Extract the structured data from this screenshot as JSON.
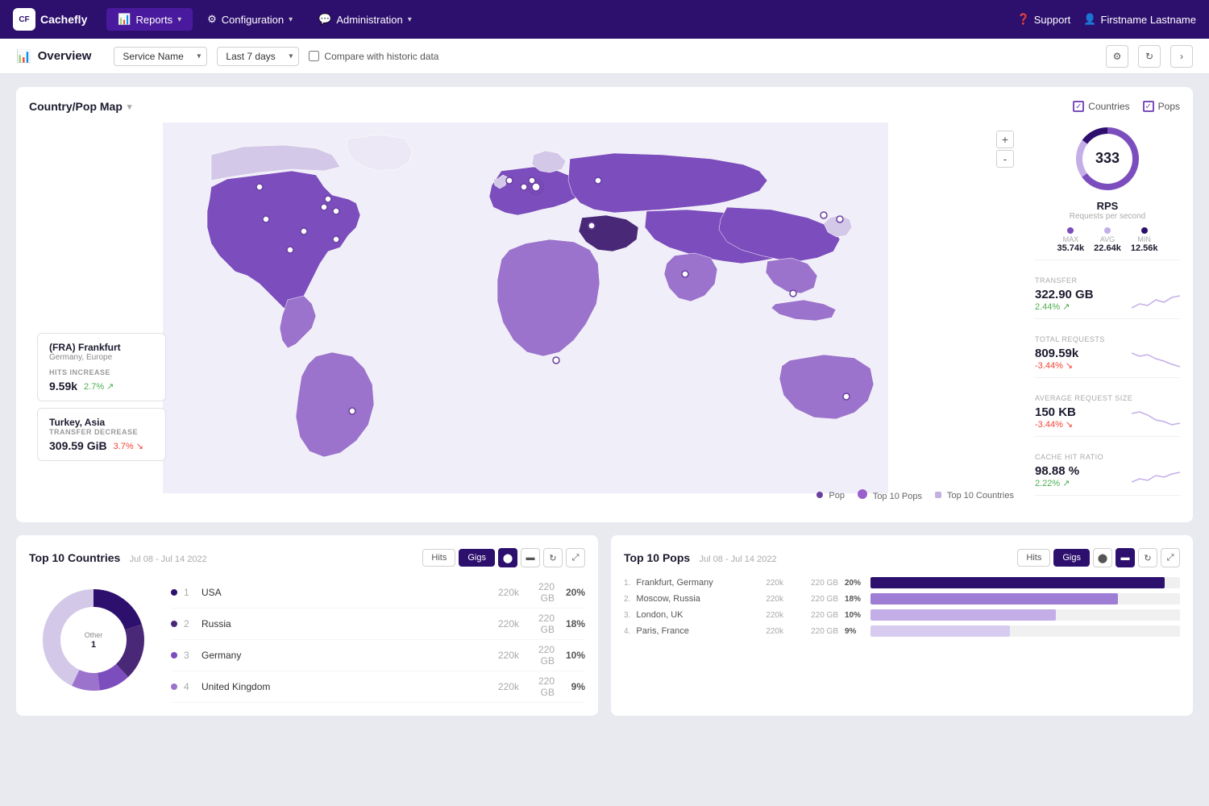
{
  "nav": {
    "logo": "Cachefly",
    "items": [
      {
        "id": "reports",
        "label": "Reports",
        "active": true,
        "icon": "📊"
      },
      {
        "id": "configuration",
        "label": "Configuration",
        "active": false,
        "icon": "⚙"
      },
      {
        "id": "administration",
        "label": "Administration",
        "active": false,
        "icon": "💬"
      }
    ],
    "support_label": "Support",
    "user_label": "Firstname Lastname"
  },
  "toolbar": {
    "title": "Overview",
    "service_name_placeholder": "Service Name",
    "date_range_placeholder": "Last 7 days",
    "compare_label": "Compare with historic data",
    "filter_icon": "filter-icon",
    "refresh_icon": "refresh-icon",
    "forward_icon": "forward-icon"
  },
  "map": {
    "title": "Country/Pop Map",
    "legend_countries": "Countries",
    "legend_pops": "Pops",
    "zoom_in": "+",
    "zoom_out": "-",
    "cards": [
      {
        "id": "frankfurt",
        "title": "(FRA) Frankfurt",
        "subtitle": "Germany, Europe",
        "stat_label": "HITS INCREASE",
        "value": "9.59k",
        "pct": "2.7%",
        "direction": "up"
      },
      {
        "id": "turkey",
        "title": "Turkey, Asia",
        "subtitle": "",
        "stat_label": "TRANSFER DECREASE",
        "value": "309.59 GiB",
        "pct": "3.7%",
        "direction": "down"
      }
    ],
    "bottom_legend": [
      {
        "label": "Pop",
        "color": "#6b3fa0"
      },
      {
        "label": "Top 10 Pops",
        "color": "#9b5fcc"
      },
      {
        "label": "Top 10 Countries",
        "color": "#c4b0e0"
      }
    ]
  },
  "rps": {
    "value": "333",
    "title": "RPS",
    "subtitle": "Requests per second",
    "stats": [
      {
        "label": "MAX",
        "value": "35.74k",
        "color": "#7c4dbd"
      },
      {
        "label": "AVG",
        "value": "22.64k",
        "color": "#c4aee8"
      },
      {
        "label": "MIN",
        "value": "12.56k",
        "color": "#2d0f6e"
      }
    ],
    "donut_segments": [
      {
        "color": "#7c4dbd",
        "pct": 65
      },
      {
        "color": "#c4aee8",
        "pct": 20
      },
      {
        "color": "#2d0f6e",
        "pct": 15
      }
    ]
  },
  "metrics": [
    {
      "id": "transfer",
      "label": "TRANSFER",
      "value": "322.90 GB",
      "pct": "2.44%",
      "direction": "up",
      "sparkline": "up"
    },
    {
      "id": "total_requests",
      "label": "TOTAL REQUESTS",
      "value": "809.59k",
      "pct": "-3.44%",
      "direction": "down",
      "sparkline": "down"
    },
    {
      "id": "avg_request_size",
      "label": "AVERAGE REQUEST SIZE",
      "value": "150 KB",
      "pct": "-3.44%",
      "direction": "down",
      "sparkline": "down"
    },
    {
      "id": "cache_hit_ratio",
      "label": "CACHE HIT RATIO",
      "value": "98.88 %",
      "pct": "2.22%",
      "direction": "up",
      "sparkline": "up"
    }
  ],
  "top_countries": {
    "title": "Top 10 Countries",
    "date_range": "Jul 08 - Jul 14 2022",
    "active_tab": "Gigs",
    "tabs": [
      "Hits",
      "Gigs"
    ],
    "rows": [
      {
        "rank": 1,
        "name": "USA",
        "color": "#2d0f6e",
        "hits": "220k",
        "gigs": "220 GB",
        "pct": "20%"
      },
      {
        "rank": 2,
        "name": "Russia",
        "color": "#4a2878",
        "hits": "220k",
        "gigs": "220 GB",
        "pct": "18%"
      },
      {
        "rank": 3,
        "name": "Germany",
        "color": "#7c4dbd",
        "hits": "220k",
        "gigs": "220 GB",
        "pct": "10%"
      },
      {
        "rank": 4,
        "name": "United Kingdom",
        "color": "#9b73cc",
        "hits": "220k",
        "gigs": "220 GB",
        "pct": "9%"
      }
    ],
    "other_label": "Other"
  },
  "top_pops": {
    "title": "Top 10 Pops",
    "date_range": "Jul 08 - Jul 14 2022",
    "active_tab": "Gigs",
    "tabs": [
      "Hits",
      "Gigs"
    ],
    "rows": [
      {
        "rank": 1,
        "name": "Frankfurt, Germany",
        "hits": "220k",
        "gigs": "220 GB",
        "pct": "20%",
        "bar_pct": 95
      },
      {
        "rank": 2,
        "name": "Moscow, Russia",
        "hits": "220k",
        "gigs": "220 GB",
        "pct": "18%",
        "bar_pct": 80
      },
      {
        "rank": 3,
        "name": "London, UK",
        "hits": "220k",
        "gigs": "220 GB",
        "pct": "10%",
        "bar_pct": 60
      },
      {
        "rank": 4,
        "name": "Paris, France",
        "hits": "220k",
        "gigs": "220 GB",
        "pct": "9%",
        "bar_pct": 45
      }
    ]
  }
}
